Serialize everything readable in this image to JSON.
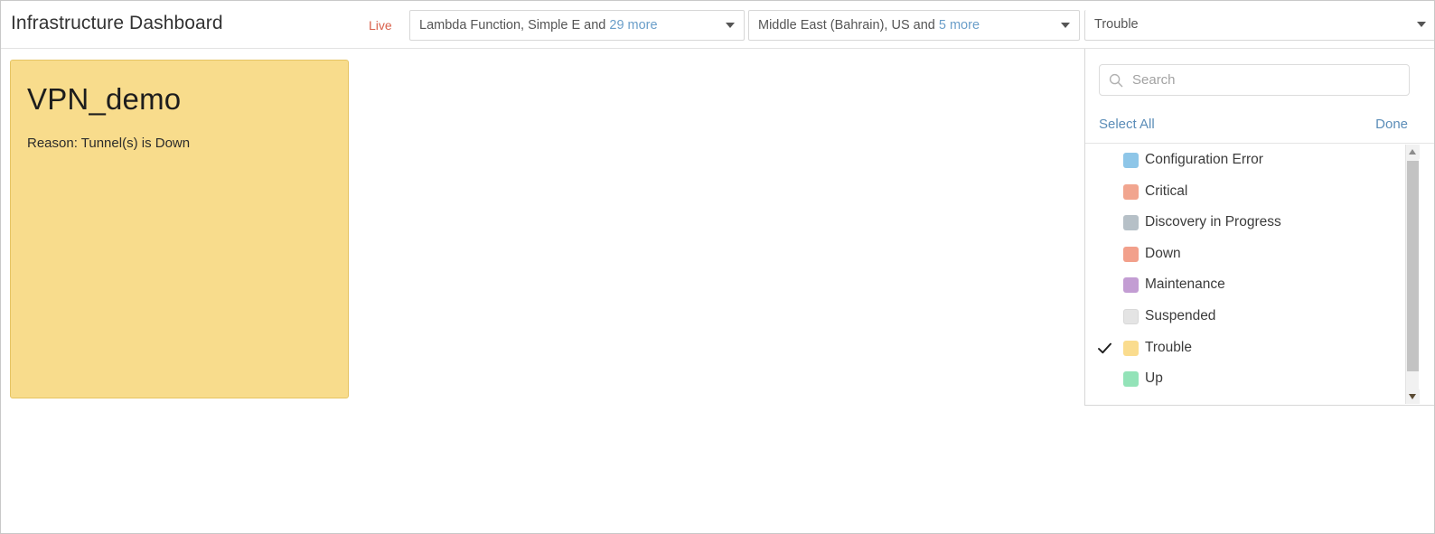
{
  "header": {
    "title": "Infrastructure Dashboard",
    "live_label": "Live",
    "resource_filter": {
      "text": "Lambda Function, Simple E and ",
      "more": "29 more",
      "caret_icon": "chevron-down-icon"
    },
    "region_filter": {
      "text": "Middle East (Bahrain), US and ",
      "more": "5 more",
      "caret_icon": "chevron-down-icon"
    },
    "status_filter": {
      "text": "Trouble",
      "caret_icon": "chevron-down-icon"
    }
  },
  "dropdown": {
    "search": {
      "placeholder": "Search",
      "value": "",
      "icon": "search-icon"
    },
    "select_all_label": "Select All",
    "done_label": "Done",
    "options": [
      {
        "label": "Configuration Error",
        "color": "#8ec6e8",
        "selected": false
      },
      {
        "label": "Critical",
        "color": "#f1a58f",
        "selected": false
      },
      {
        "label": "Discovery in Progress",
        "color": "#b6c0c7",
        "selected": false
      },
      {
        "label": "Down",
        "color": "#f2a08b",
        "selected": false
      },
      {
        "label": "Maintenance",
        "color": "#c39dd3",
        "selected": false
      },
      {
        "label": "Suspended",
        "color": "#e4e4e4",
        "selected": false
      },
      {
        "label": "Trouble",
        "color": "#fadc8e",
        "selected": true
      },
      {
        "label": "Up",
        "color": "#93e3b8",
        "selected": false
      }
    ],
    "scrollbar": {
      "up_icon": "scroll-up-arrow-icon",
      "down_icon": "scroll-down-arrow-icon"
    }
  },
  "board": {
    "cards": [
      {
        "title": "VPN_demo",
        "reason": "Reason: Tunnel(s) is Down",
        "color": "#f8dc8c"
      }
    ]
  },
  "colors": {
    "accent_link": "#5b8db8",
    "live": "#d9614c",
    "trouble": "#f8dc8c"
  }
}
